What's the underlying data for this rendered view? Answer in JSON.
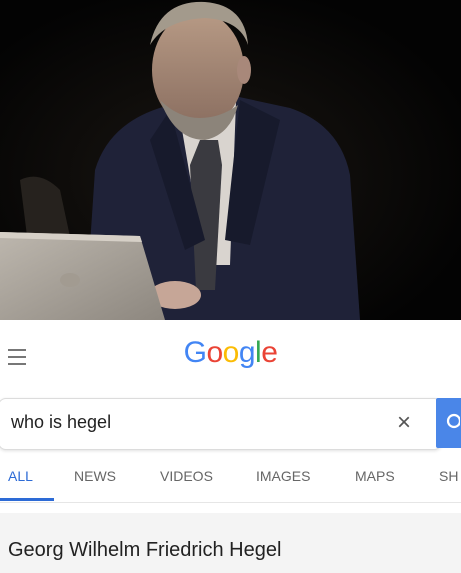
{
  "header": {
    "logo_letters": [
      {
        "ch": "G",
        "color": "#4285F4"
      },
      {
        "ch": "o",
        "color": "#EA4335"
      },
      {
        "ch": "o",
        "color": "#FBBC05"
      },
      {
        "ch": "g",
        "color": "#4285F4"
      },
      {
        "ch": "l",
        "color": "#34A853"
      },
      {
        "ch": "e",
        "color": "#EA4335"
      }
    ],
    "menu_icon": "hamburger-menu-icon"
  },
  "search": {
    "value": "who is hegel",
    "clear_icon": "×",
    "button_icon": "search-icon",
    "button_color": "#4a86e8"
  },
  "tabs": [
    {
      "label": "ALL",
      "active": true
    },
    {
      "label": "NEWS",
      "active": false
    },
    {
      "label": "VIDEOS",
      "active": false
    },
    {
      "label": "IMAGES",
      "active": false
    },
    {
      "label": "MAPS",
      "active": false
    },
    {
      "label": "SH",
      "active": false
    }
  ],
  "result": {
    "title": "Georg Wilhelm Friedrich Hegel"
  },
  "colors": {
    "accent": "#2d6bd6",
    "photo_background": "#050505",
    "suit": "#1f2238"
  }
}
